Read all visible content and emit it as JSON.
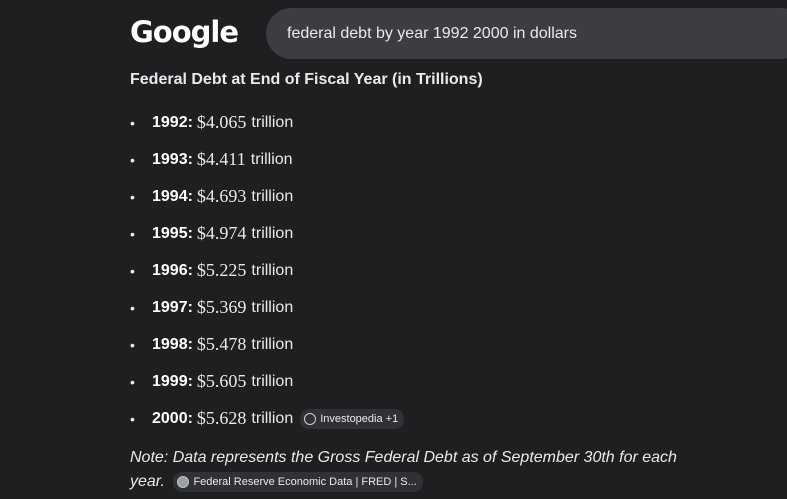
{
  "header": {
    "logo_text": "Google",
    "search_query": "federal debt by year 1992 2000 in dollars"
  },
  "answer": {
    "heading": "Federal Debt at End of Fiscal Year (in Trillions)",
    "items": [
      {
        "year": "1992:",
        "amount": "$4.065",
        "unit": "trillion"
      },
      {
        "year": "1993:",
        "amount": "$4.411",
        "unit": "trillion"
      },
      {
        "year": "1994:",
        "amount": "$4.693",
        "unit": "trillion"
      },
      {
        "year": "1995:",
        "amount": "$4.974",
        "unit": "trillion"
      },
      {
        "year": "1996:",
        "amount": "$5.225",
        "unit": "trillion"
      },
      {
        "year": "1997:",
        "amount": "$5.369",
        "unit": "trillion"
      },
      {
        "year": "1998:",
        "amount": "$5.478",
        "unit": "trillion"
      },
      {
        "year": "1999:",
        "amount": "$5.605",
        "unit": "trillion"
      },
      {
        "year": "2000:",
        "amount": "$5.628",
        "unit": "trillion"
      }
    ],
    "source_chip": "Investopedia +1",
    "note": "Note: Data represents the Gross Federal Debt as of September 30th for each year.",
    "note_source_chip": "Federal Reserve Economic Data | FRED | S..."
  },
  "colors": {
    "background": "#1f1f21",
    "search_box": "#3c3d41",
    "text": "#e8eaed",
    "chip_background": "#303134"
  },
  "icons": {
    "bullet": "•",
    "source_icon": "globe-icon",
    "fred_icon": "fred-logo-icon"
  }
}
